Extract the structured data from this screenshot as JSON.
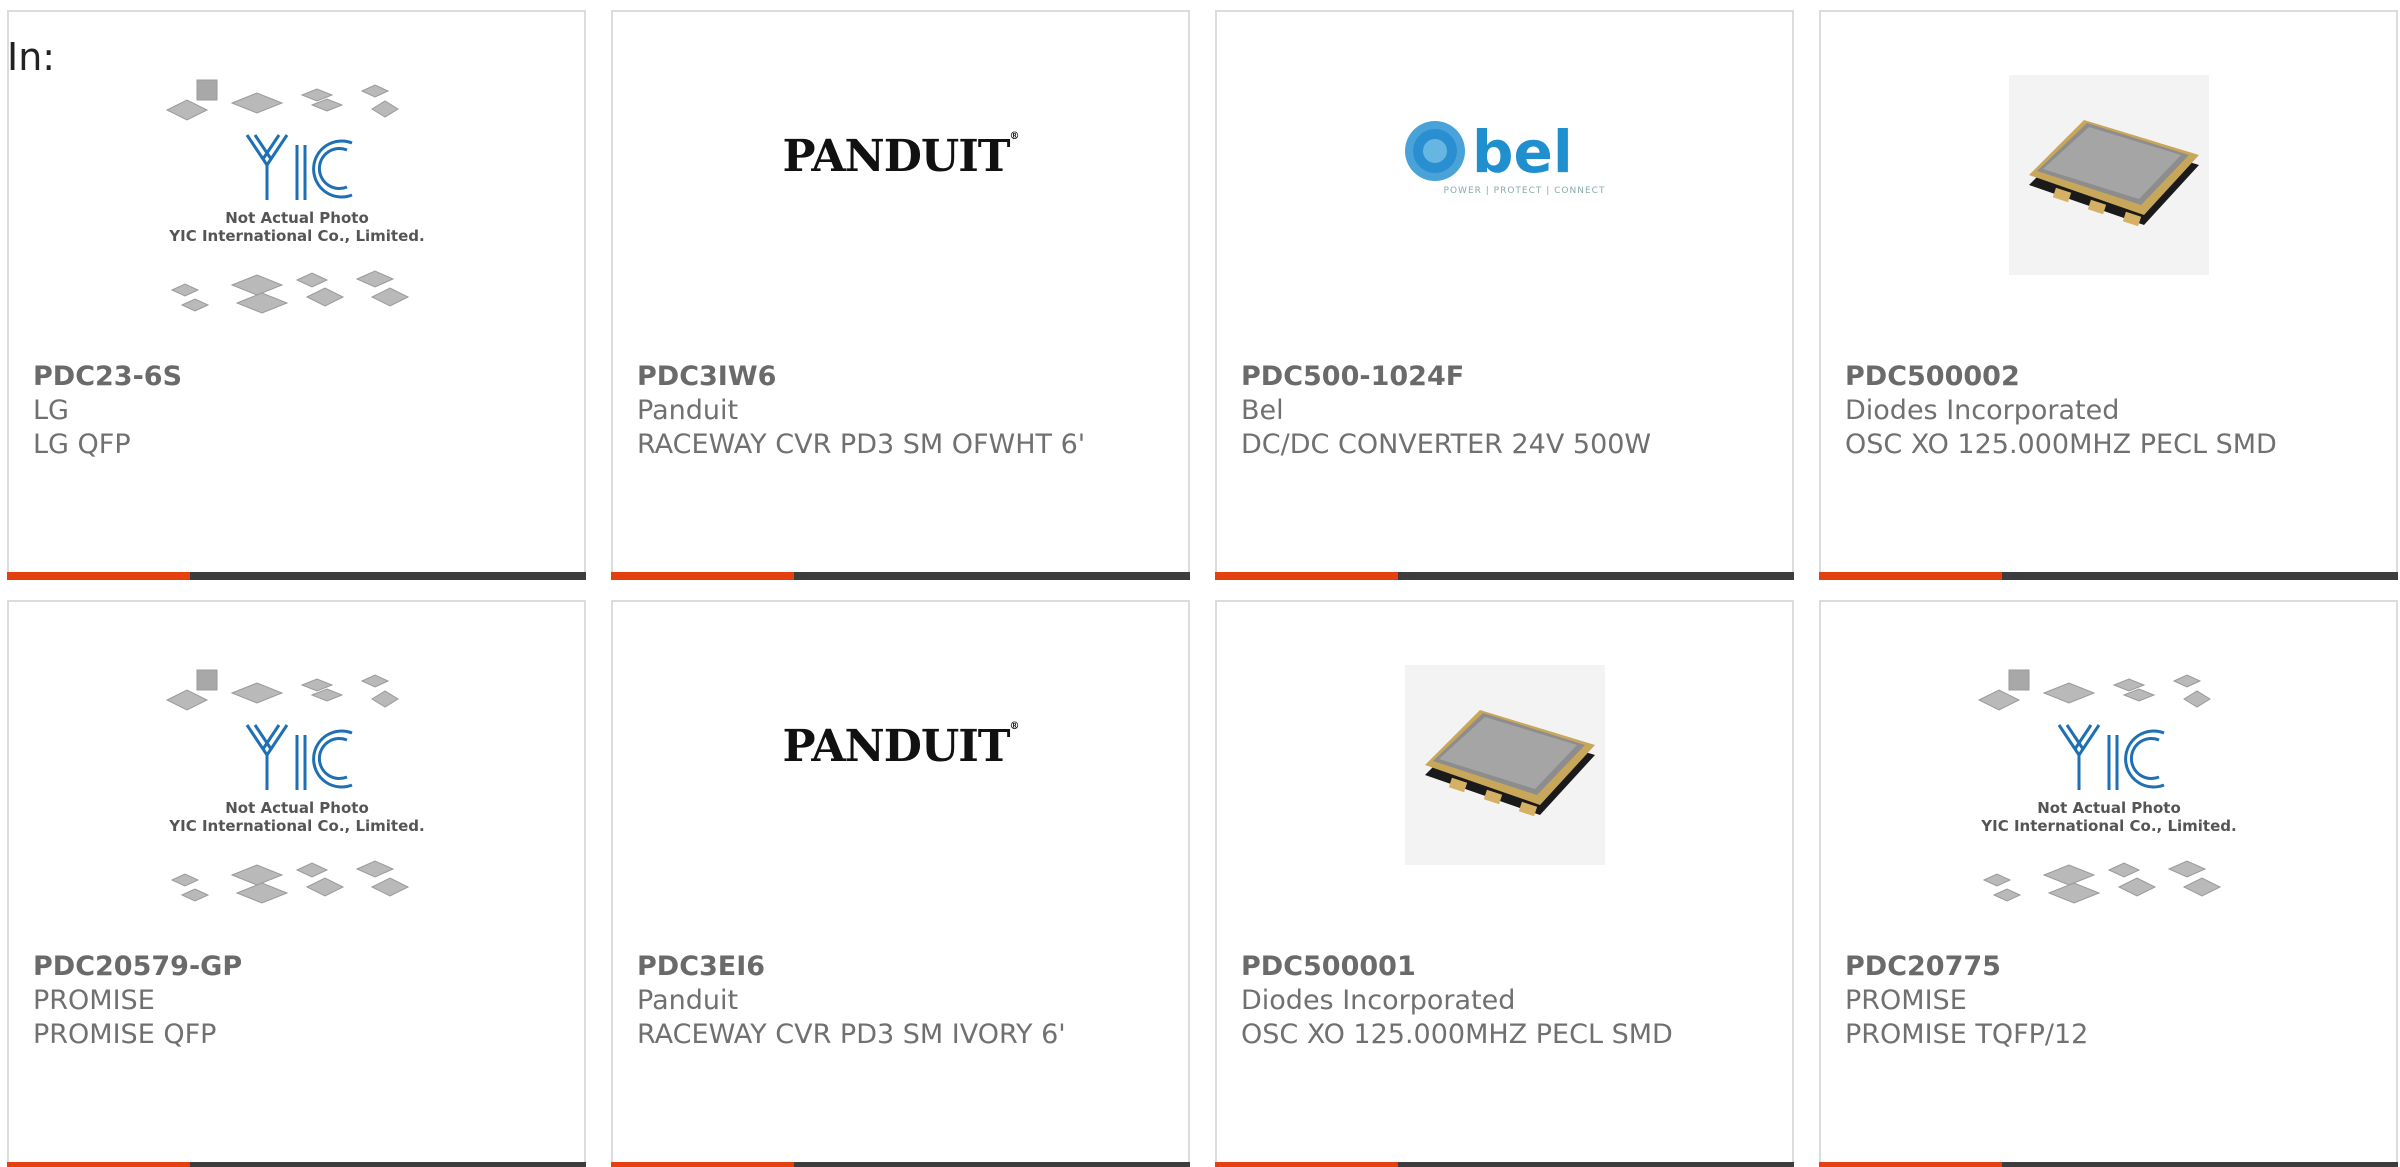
{
  "header": {
    "in_label": "In:"
  },
  "products": [
    {
      "part": "PDC23-6S",
      "manufacturer": "LG",
      "description": "LG QFP",
      "image": "yic-placeholder-image",
      "placeholder_line1": "Not Actual Photo",
      "placeholder_line2": "YIC International Co., Limited.",
      "placeholder_brand": "YIC"
    },
    {
      "part": "PDC3IW6",
      "manufacturer": "Panduit",
      "description": "RACEWAY CVR PD3 SM OFWHT 6'",
      "image": "panduit-logo",
      "logo_text": "PANDUIT"
    },
    {
      "part": "PDC500-1024F",
      "manufacturer": "Bel",
      "description": "DC/DC CONVERTER 24V 500W",
      "image": "bel-logo",
      "logo_text": "bel",
      "logo_tagline": "POWER | PROTECT | CONNECT"
    },
    {
      "part": "PDC500002",
      "manufacturer": "Diodes Incorporated",
      "description": "OSC XO 125.000MHZ PECL SMD",
      "image": "oscillator-photo"
    },
    {
      "part": "PDC20579-GP",
      "manufacturer": "PROMISE",
      "description": "PROMISE QFP",
      "image": "yic-placeholder-image",
      "placeholder_line1": "Not Actual Photo",
      "placeholder_line2": "YIC International Co., Limited.",
      "placeholder_brand": "YIC"
    },
    {
      "part": "PDC3EI6",
      "manufacturer": "Panduit",
      "description": "RACEWAY CVR PD3 SM IVORY 6'",
      "image": "panduit-logo",
      "logo_text": "PANDUIT"
    },
    {
      "part": "PDC500001",
      "manufacturer": "Diodes Incorporated",
      "description": "OSC XO 125.000MHZ PECL SMD",
      "image": "oscillator-photo"
    },
    {
      "part": "PDC20775",
      "manufacturer": "PROMISE",
      "description": "PROMISE TQFP/12",
      "image": "yic-placeholder-image",
      "placeholder_line1": "Not Actual Photo",
      "placeholder_line2": "YIC International Co., Limited.",
      "placeholder_brand": "YIC"
    }
  ],
  "colors": {
    "accent": "#e5400f",
    "bar": "#3d3d3d",
    "border": "#dcdcdc",
    "text": "#707070",
    "yic_blue": "#1f6fb5",
    "bel_blue": "#1f8fce"
  }
}
